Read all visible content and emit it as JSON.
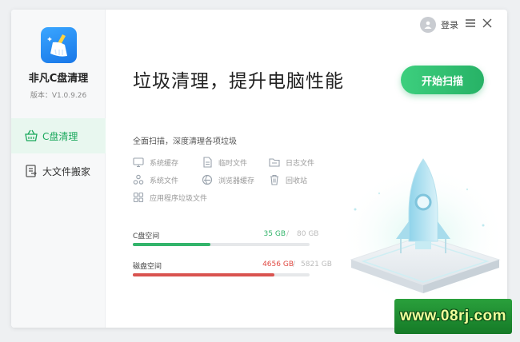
{
  "app": {
    "name": "非凡C盘清理",
    "version": "版本：V1.0.9.26"
  },
  "header": {
    "login_label": "登录",
    "menu_icon": "menu-icon",
    "close_icon": "close-icon"
  },
  "sidebar": {
    "items": [
      {
        "label": "C盘清理",
        "icon": "basket-icon",
        "active": true
      },
      {
        "label": "大文件搬家",
        "icon": "file-move-icon",
        "active": false
      }
    ]
  },
  "main": {
    "title": "垃圾清理，提升电脑性能",
    "scan_button": "开始扫描",
    "subtitle": "全面扫描，深度清理各项垃圾",
    "scan_items": [
      {
        "label": "系统缓存",
        "icon": "monitor-icon"
      },
      {
        "label": "临时文件",
        "icon": "temp-file-icon"
      },
      {
        "label": "日志文件",
        "icon": "folder-icon"
      },
      {
        "label": "系统文件",
        "icon": "system-files-icon"
      },
      {
        "label": "浏览器缓存",
        "icon": "browser-icon"
      },
      {
        "label": "回收站",
        "icon": "recycle-bin-icon"
      },
      {
        "label": "应用程序垃圾文件",
        "icon": "apps-icon"
      }
    ]
  },
  "disks": [
    {
      "label": "C盘空间",
      "used": "35 GB",
      "separator": " / ",
      "total": "80 GB",
      "fill": 0.44,
      "color": "#33b46b",
      "used_color": "#33b46b"
    },
    {
      "label": "磁盘空间",
      "used": "4656 GB",
      "separator": " / ",
      "total": "5821 GB",
      "fill": 0.8,
      "color": "#d9534f",
      "used_color": "#e04a43"
    }
  ],
  "colors": {
    "accent": "#27b266",
    "danger": "#d9534f"
  },
  "watermark": {
    "text": "www.08rj.com"
  }
}
